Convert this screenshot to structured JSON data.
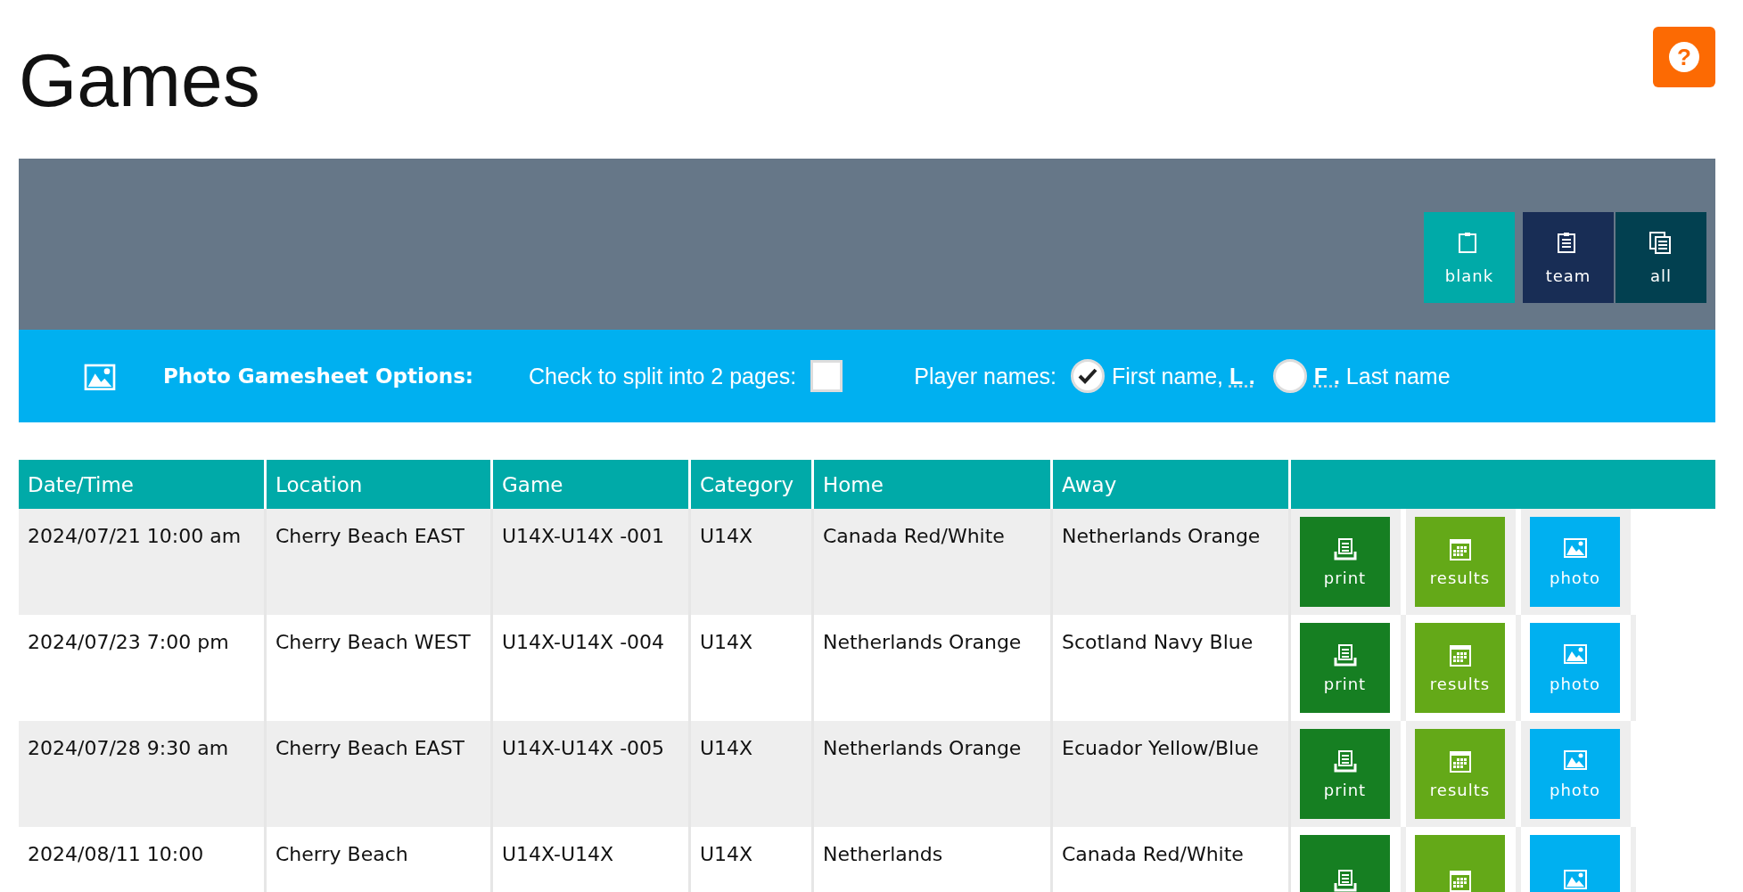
{
  "page": {
    "title": "Games",
    "help": "?"
  },
  "sheet_buttons": [
    {
      "label": "blank",
      "kind": "blank"
    },
    {
      "label": "team",
      "kind": "team"
    },
    {
      "label": "all",
      "kind": "all"
    }
  ],
  "options": {
    "title": "Photo Gamesheet Options:",
    "split_label": "Check to split into 2 pages:",
    "split_checked": false,
    "names_label": "Player names:",
    "name_formats": [
      {
        "before": "First name, ",
        "abbr": "L .",
        "selected": true
      },
      {
        "abbr": "F .",
        "after": " Last name",
        "selected": false
      }
    ]
  },
  "table": {
    "columns": [
      "Date/Time",
      "Location",
      "Game",
      "Category",
      "Home",
      "Away"
    ],
    "rows": [
      {
        "datetime": "2024/07/21 10:00 am",
        "location": "Cherry Beach EAST",
        "game": "U14X-U14X -001",
        "category": "U14X",
        "home": "Canada Red/White",
        "away": "Netherlands Orange",
        "actions": [
          {
            "kind": "print",
            "label": "print"
          },
          {
            "kind": "results",
            "label": "results"
          },
          {
            "kind": "photo",
            "label": "photo"
          }
        ]
      },
      {
        "datetime": "2024/07/23 7:00 pm",
        "location": "Cherry Beach WEST",
        "game": "U14X-U14X -004",
        "category": "U14X",
        "home": "Netherlands Orange",
        "away": "Scotland Navy Blue",
        "actions": [
          {
            "kind": "print",
            "label": "print"
          },
          {
            "kind": "results",
            "label": "results"
          },
          {
            "kind": "photo",
            "label": "photo"
          }
        ]
      },
      {
        "datetime": "2024/07/28 9:30 am",
        "location": "Cherry Beach EAST",
        "game": "U14X-U14X -005",
        "category": "U14X",
        "home": "Netherlands Orange",
        "away": "Ecuador Yellow/Blue",
        "actions": [
          {
            "kind": "print",
            "label": "print"
          },
          {
            "kind": "results",
            "label": "results"
          },
          {
            "kind": "photo",
            "label": "photo"
          }
        ]
      },
      {
        "datetime": "2024/08/11 10:00",
        "location": "Cherry Beach",
        "game": "U14X-U14X",
        "category": "U14X",
        "home": "Netherlands",
        "away": "Canada Red/White",
        "actions": [
          {
            "kind": "print"
          },
          {
            "kind": "results"
          },
          {
            "kind": "photo"
          }
        ]
      }
    ]
  }
}
